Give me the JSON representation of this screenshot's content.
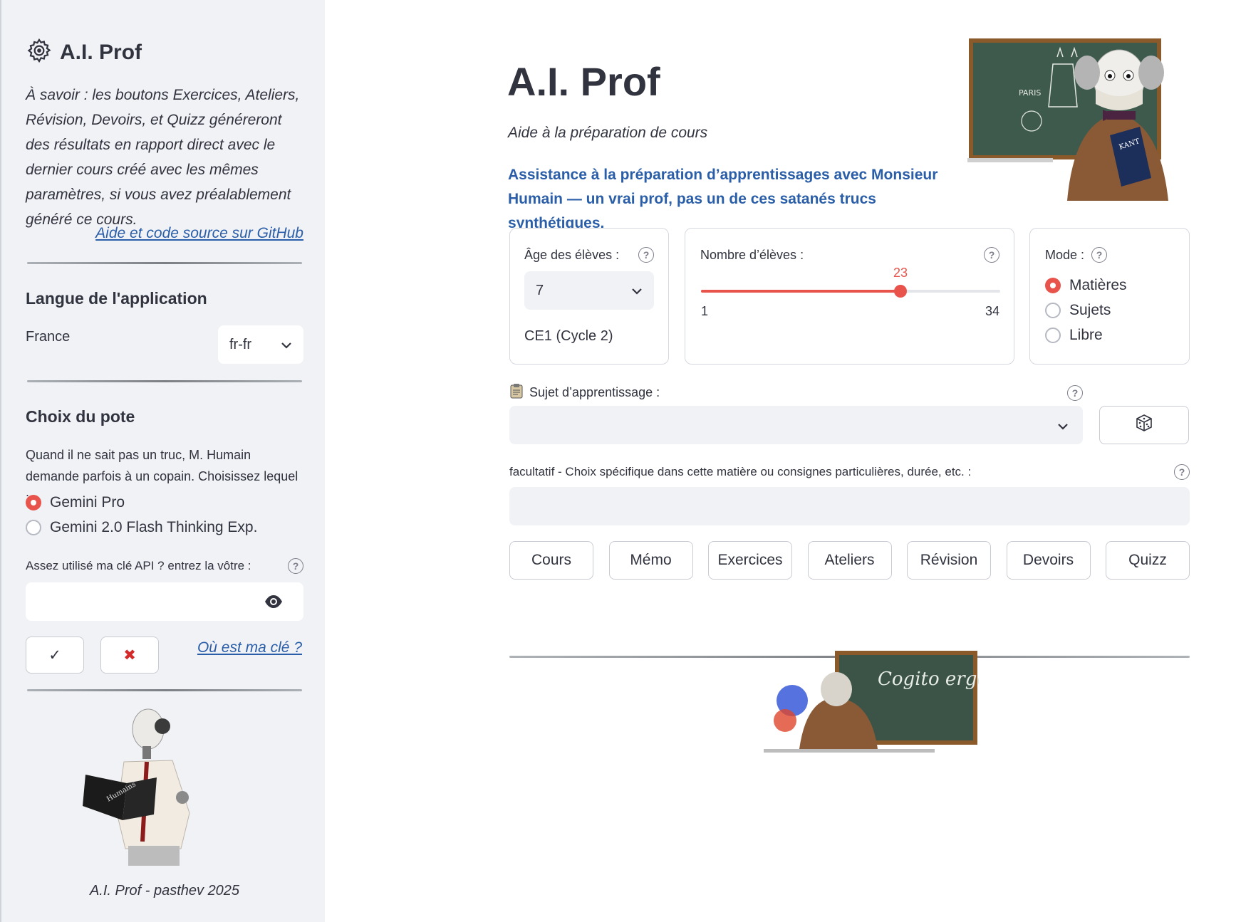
{
  "sidebar": {
    "title": "A.I. Prof",
    "note": "À savoir : les boutons Exercices, Ateliers, Révision, Devoirs, et Quizz généreront des résultats en rapport direct avec le dernier cours créé avec les mêmes paramètres, si vous avez préalablement généré ce cours.",
    "github_link": "Aide et code source sur GitHub",
    "language": {
      "heading": "Langue de l'application",
      "country": "France",
      "selected": "fr-fr"
    },
    "buddy": {
      "heading": "Choix du pote",
      "description": "Quand il ne sait pas un truc, M. Humain demande parfois à un copain. Choisissez lequel :",
      "options": [
        "Gemini Pro",
        "Gemini 2.0 Flash Thinking Exp."
      ],
      "selected_index": 0
    },
    "api": {
      "label": "Assez utilisé ma clé API ? entrez la vôtre :",
      "value": "",
      "confirm": "✓",
      "cancel": "✖",
      "where_link": "Où est ma clé ?"
    },
    "robot_book_text": "Humains",
    "footer": "A.I. Prof - pasthev 2025"
  },
  "main": {
    "title": "A.I. Prof",
    "subtitle": "Aide à la préparation de cours",
    "tagline": "Assistance à la préparation d’apprentissages avec Monsieur Humain — un vrai prof, pas un de ces satanés trucs synthétiques.",
    "hero": {
      "board_text": "PARIS",
      "book_text": "KANT"
    },
    "age": {
      "label": "Âge des élèves :",
      "value": "7",
      "level": "CE1 (Cycle 2)"
    },
    "students": {
      "label": "Nombre d’élèves :",
      "value": 23,
      "min": 1,
      "max": 34
    },
    "mode": {
      "label": "Mode :",
      "options": [
        "Matières",
        "Sujets",
        "Libre"
      ],
      "selected_index": 0
    },
    "subject": {
      "label": "Sujet d’apprentissage :",
      "value": ""
    },
    "optional": {
      "label": "facultatif - Choix spécifique dans cette matière ou consignes particulières, durée, etc. :",
      "value": ""
    },
    "actions": [
      "Cours",
      "Mémo",
      "Exercices",
      "Ateliers",
      "Révision",
      "Devoirs",
      "Quizz"
    ],
    "footer_board_text": "Cogito ergo su"
  },
  "colors": {
    "accent": "#e8544b",
    "link": "#2a5ea8",
    "sidebar_bg": "#f0f2f6"
  }
}
